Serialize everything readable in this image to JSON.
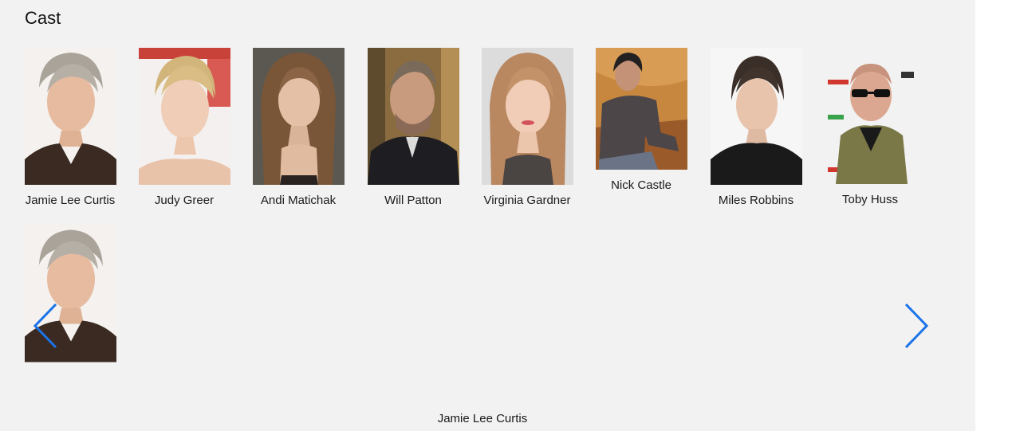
{
  "section": {
    "title": "Cast"
  },
  "cast": [
    {
      "name": "Jamie Lee Curtis"
    },
    {
      "name": "Judy Greer"
    },
    {
      "name": "Andi Matichak"
    },
    {
      "name": "Will Patton"
    },
    {
      "name": "Virginia Gardner"
    },
    {
      "name": "Nick Castle"
    },
    {
      "name": "Miles Robbins"
    },
    {
      "name": "Toby Huss"
    }
  ],
  "carousel": {
    "active_name": "Jamie Lee Curtis",
    "arrow_color": "#1a73e8",
    "prev_icon": "chevron-left-icon",
    "next_icon": "chevron-right-icon"
  },
  "colors": {
    "panel_background": "#f2f2f2",
    "page_background": "#ffffff"
  }
}
